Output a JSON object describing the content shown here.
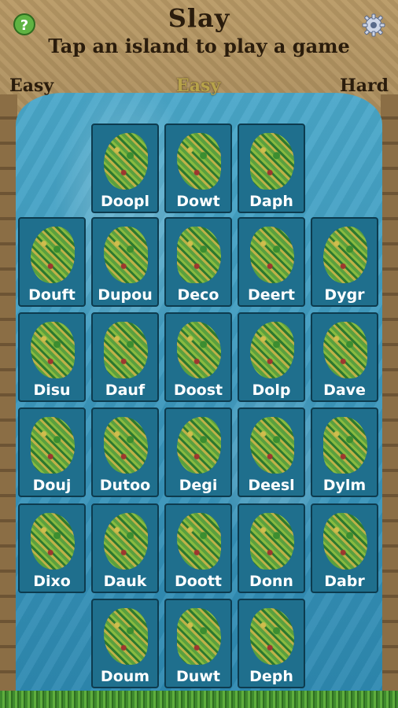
{
  "header": {
    "title": "Slay",
    "subtitle": "Tap an island to play a game",
    "difficulty_left": "Easy",
    "difficulty_current": "Easy",
    "difficulty_right": "Hard",
    "help_label": "?"
  },
  "icons": {
    "help": "help-icon",
    "settings": "gear-icon"
  },
  "islands": [
    [
      "",
      "Doopl",
      "Dowt",
      "Daph",
      ""
    ],
    [
      "Douft",
      "Dupou",
      "Deco",
      "Deert",
      "Dygr"
    ],
    [
      "Disu",
      "Dauf",
      "Doost",
      "Dolp",
      "Dave"
    ],
    [
      "Douj",
      "Dutoo",
      "Degi",
      "Deesl",
      "Dylm"
    ],
    [
      "Dixo",
      "Dauk",
      "Doott",
      "Donn",
      "Dabr"
    ],
    [
      "",
      "Doum",
      "Duwt",
      "Deph",
      ""
    ]
  ]
}
